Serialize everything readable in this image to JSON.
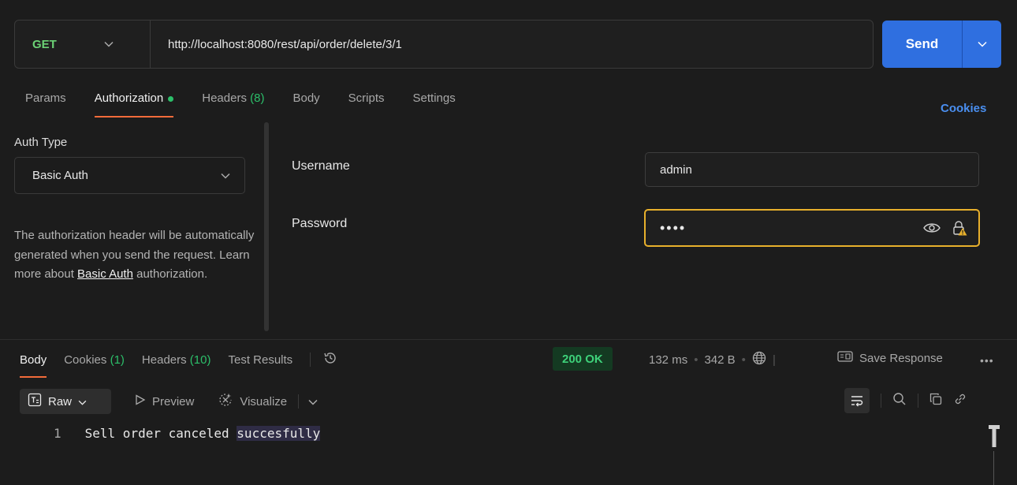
{
  "request": {
    "method": "GET",
    "url": "http://localhost:8080/rest/api/order/delete/3/1",
    "send_label": "Send"
  },
  "request_tabs": {
    "params": "Params",
    "authorization": "Authorization",
    "headers": "Headers",
    "headers_count": "(8)",
    "body": "Body",
    "scripts": "Scripts",
    "settings": "Settings"
  },
  "cookies_link": "Cookies",
  "auth": {
    "type_label": "Auth Type",
    "type_value": "Basic Auth",
    "desc_part1": "The authorization header will be automatically generated when you send the request. Learn more about ",
    "desc_link": "Basic Auth",
    "desc_part2": " authorization.",
    "username_label": "Username",
    "username_value": "admin",
    "password_label": "Password",
    "password_value": "••••"
  },
  "response_tabs": {
    "body": "Body",
    "cookies": "Cookies",
    "cookies_count": "(1)",
    "headers": "Headers",
    "headers_count": "(10)",
    "test_results": "Test Results"
  },
  "response_meta": {
    "status": "200 OK",
    "time": "132 ms",
    "size": "342 B",
    "save_response": "Save Response"
  },
  "response_toolbar": {
    "raw": "Raw",
    "preview": "Preview",
    "visualize": "Visualize"
  },
  "response_body": {
    "line_number": "1",
    "text_before": "Sell order canceled ",
    "text_highlight": "succesfully"
  },
  "colors": {
    "accent_orange": "#f26b3a",
    "send_blue": "#2f6fe0",
    "method_green": "#6bd175",
    "status_green": "#3ed17a",
    "focus_yellow": "#e8b02c",
    "link_blue": "#4a8ff0"
  }
}
